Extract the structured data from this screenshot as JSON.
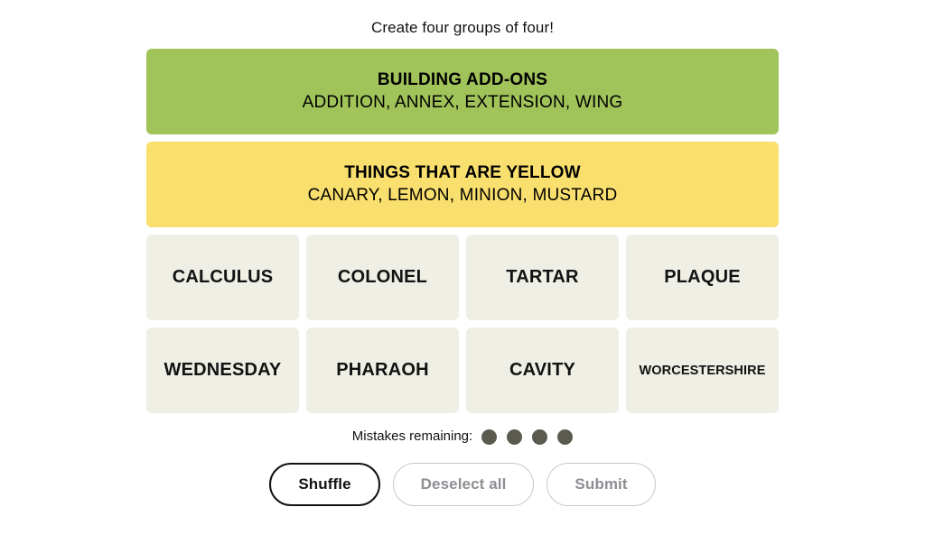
{
  "instruction": "Create four groups of four!",
  "colors": {
    "green": "#a0c35a",
    "yellow": "#f9df6d",
    "tile": "#efefe6",
    "dot": "#5a5a4e",
    "text": "#121212",
    "disabled_text": "#8e8e93",
    "disabled_border": "#c8c8c8"
  },
  "solved_groups": [
    {
      "title": "BUILDING ADD-ONS",
      "members": "ADDITION, ANNEX, EXTENSION, WING",
      "color": "#a0c35a",
      "color_name": "green"
    },
    {
      "title": "THINGS THAT ARE YELLOW",
      "members": "CANARY, LEMON, MINION, MUSTARD",
      "color": "#f9df6d",
      "color_name": "yellow"
    }
  ],
  "tiles": [
    [
      {
        "label": "CALCULUS",
        "small": false
      },
      {
        "label": "COLONEL",
        "small": false
      },
      {
        "label": "TARTAR",
        "small": false
      },
      {
        "label": "PLAQUE",
        "small": false
      }
    ],
    [
      {
        "label": "WEDNESDAY",
        "small": false
      },
      {
        "label": "PHARAOH",
        "small": false
      },
      {
        "label": "CAVITY",
        "small": false
      },
      {
        "label": "WORCESTERSHIRE",
        "small": true
      }
    ]
  ],
  "mistakes": {
    "label": "Mistakes remaining:",
    "remaining": 4
  },
  "buttons": {
    "shuffle": "Shuffle",
    "deselect_all": "Deselect all",
    "submit": "Submit"
  }
}
